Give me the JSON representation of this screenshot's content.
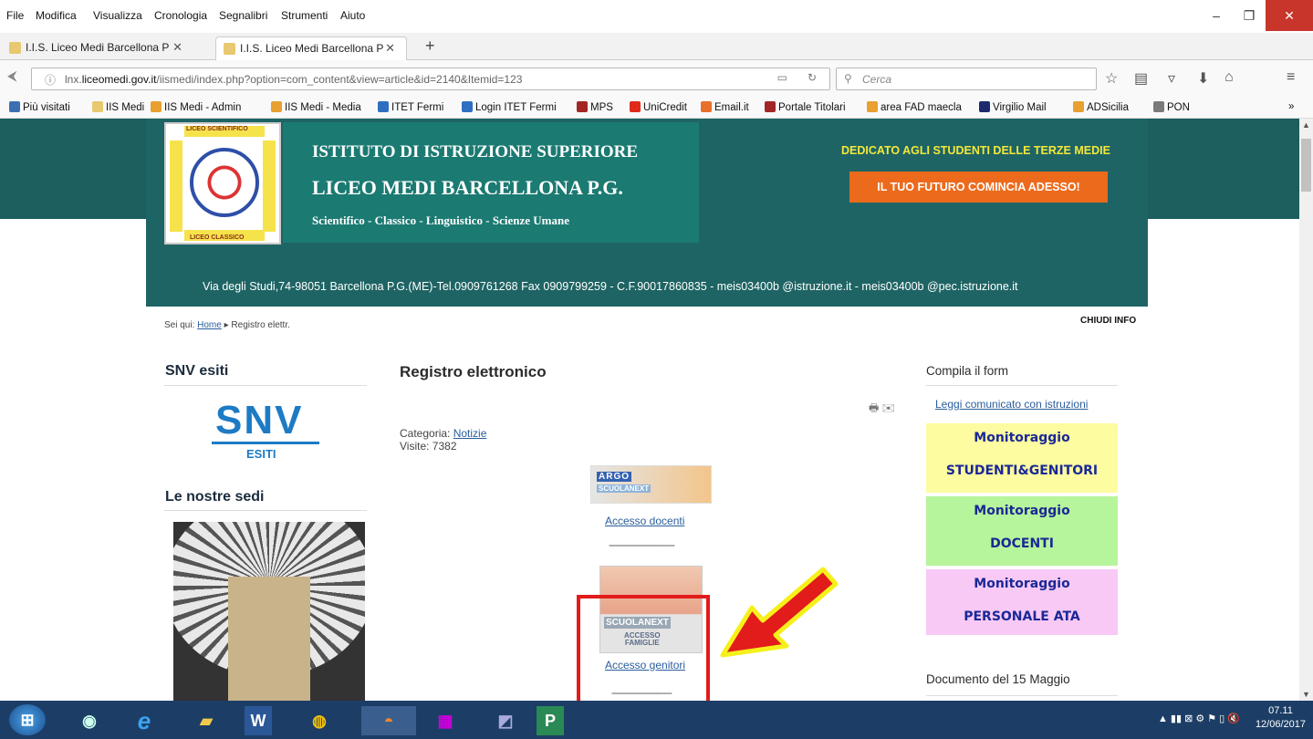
{
  "menu": {
    "items": [
      "File",
      "Modifica",
      "Visualizza",
      "Cronologia",
      "Segnalibri",
      "Strumenti",
      "Aiuto"
    ]
  },
  "tabs": [
    {
      "label": "I.I.S. Liceo Medi Barcellona P"
    },
    {
      "label": "I.I.S. Liceo Medi Barcellona P"
    }
  ],
  "navbar": {
    "url_prefix": "lnx.",
    "url_domain": "liceomedi.gov.it",
    "url_path": "/iismedi/index.php?option=com_content&view=article&id=2140&Itemid=123",
    "search_placeholder": "Cerca"
  },
  "bookmarks": [
    {
      "label": "Più visitati",
      "color": "#3c6fb2"
    },
    {
      "label": "IIS Medi",
      "color": "#e8c870"
    },
    {
      "label": "IIS Medi - Admin",
      "color": "#e8a030"
    },
    {
      "label": "IIS Medi - Media",
      "color": "#e8a030"
    },
    {
      "label": "ITET Fermi",
      "color": "#2f6fc1"
    },
    {
      "label": "Login ITET Fermi",
      "color": "#2f6fc1"
    },
    {
      "label": "MPS",
      "color": "#a32626"
    },
    {
      "label": "UniCredit",
      "color": "#e12a1a"
    },
    {
      "label": "Email.it",
      "color": "#e8702a"
    },
    {
      "label": "Portale Titolari",
      "color": "#a32626"
    },
    {
      "label": "area FAD maecla",
      "color": "#e8a030"
    },
    {
      "label": "Virgilio Mail",
      "color": "#1b2b6c"
    },
    {
      "label": "ADSicilia",
      "color": "#e8a030"
    },
    {
      "label": "PON",
      "color": "#7a7a7a"
    }
  ],
  "banner": {
    "logo_top": "LICEO SCIENTIFICO",
    "logo_bottom": "LICEO CLASSICO",
    "line1": "ISTITUTO DI ISTRUZIONE SUPERIORE",
    "line2": "LICEO MEDI BARCELLONA P.G.",
    "line3": "Scientifico - Classico - Linguistico - Scienze Umane",
    "dedicato": "DEDICATO AGLI STUDENTI DELLE TERZE MEDIE",
    "futuro": "IL TUO FUTURO COMINCIA ADESSO!",
    "address": "Via degli Studi,74-98051 Barcellona P.G.(ME)-Tel.0909761268 Fax 0909799259 - C.F.90017860835 - meis03400b @istruzione.it - meis03400b @pec.istruzione.it"
  },
  "breadcrumb": {
    "prefix": "Sei qui:",
    "home": "Home",
    "sep": "▸",
    "current": "Registro elettr."
  },
  "chiudi_info": "CHIUDI INFO",
  "left": {
    "snv_title": "SNV esiti",
    "snv_logo": "SNV",
    "snv_sub": "ESITI",
    "sedi_title": "Le nostre sedi"
  },
  "content": {
    "title": "Registro elettronico",
    "categoria_label": "Categoria:",
    "categoria_link": "Notizie",
    "visite": "Visite: 7382",
    "argo_label": "ARGO",
    "argo_sub": "SCUOLANEXT",
    "accesso_docenti": "Accesso docenti",
    "dashes1": "------------------------",
    "famiglie_brand": "SCUOLANEXT",
    "famiglie_line1": "ACCESSO",
    "famiglie_line2": "FAMIGLIE",
    "accesso_genitori": "Accesso genitori",
    "dashes2": "----------------------"
  },
  "right": {
    "title": "Compila il form",
    "leggi": "Leggi comunicato con istruzioni",
    "boxes": [
      {
        "line1": "Monitoraggio",
        "line2": "STUDENTI&GENITORI",
        "color": "#fdfca0"
      },
      {
        "line1": "Monitoraggio",
        "line2": "DOCENTI",
        "color": "#b6f59b"
      },
      {
        "line1": "Monitoraggio",
        "line2": "PERSONALE ATA",
        "color": "#f8c9f5"
      }
    ],
    "doc15": "Documento del 15 Maggio"
  },
  "taskbar": {
    "time": "07.11",
    "date": "12/06/2017"
  },
  "colors": {
    "banner": "#1f6464",
    "accent_orange": "#ec6a1c",
    "highlight_red": "#e21b1b",
    "arrow_yellow": "#f6f01a"
  }
}
